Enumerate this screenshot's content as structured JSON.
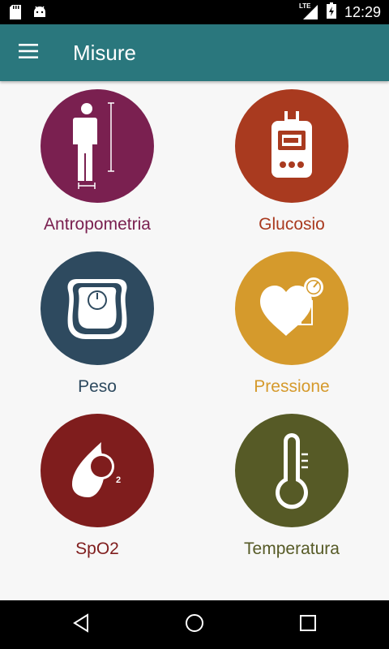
{
  "status_bar": {
    "network": "LTE",
    "time": "12:29"
  },
  "app_bar": {
    "title": "Misure",
    "menu_icon": "menu-icon"
  },
  "measures": [
    {
      "label": "Antropometria",
      "color": "#7a2050",
      "icon": "person-height-icon"
    },
    {
      "label": "Glucosio",
      "color": "#a93a1f",
      "icon": "glucometer-icon"
    },
    {
      "label": "Peso",
      "color": "#2e4a5f",
      "icon": "scale-icon"
    },
    {
      "label": "Pressione",
      "color": "#d59a2c",
      "icon": "blood-pressure-icon"
    },
    {
      "label": "SpO2",
      "color": "#7f1d1d",
      "icon": "oxygen-drop-icon"
    },
    {
      "label": "Temperatura",
      "color": "#565a26",
      "icon": "thermometer-icon"
    }
  ],
  "nav_bar": {
    "icons": [
      "back-icon",
      "home-icon",
      "recents-icon"
    ]
  }
}
